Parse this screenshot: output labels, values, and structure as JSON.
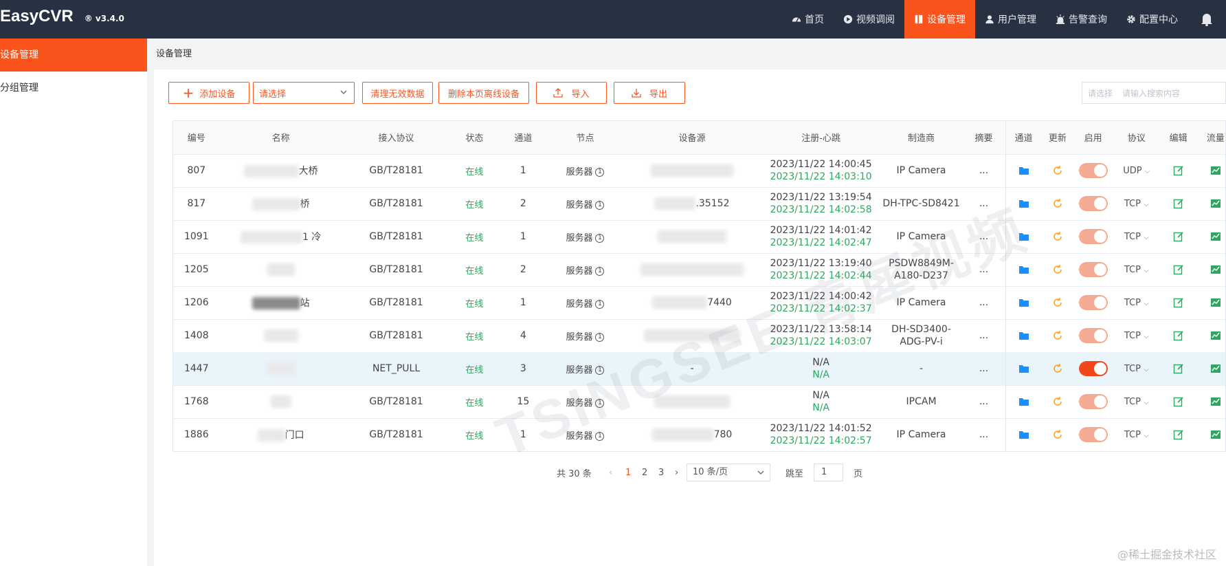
{
  "header": {
    "brand": "EasyCVR",
    "version": "® v3.4.0",
    "nav": [
      {
        "label": "首页",
        "icon": "dashboard-icon"
      },
      {
        "label": "视频调阅",
        "icon": "play-circle-icon"
      },
      {
        "label": "设备管理",
        "icon": "device-icon",
        "active": true
      },
      {
        "label": "用户管理",
        "icon": "user-icon"
      },
      {
        "label": "告警查询",
        "icon": "alarm-icon"
      },
      {
        "label": "配置中心",
        "icon": "gear-icon"
      }
    ]
  },
  "sidebar": {
    "items": [
      {
        "label": "设备管理",
        "active": true
      },
      {
        "label": "分组管理"
      }
    ]
  },
  "breadcrumb": "设备管理",
  "toolbar": {
    "add_label": "添加设备",
    "select_placeholder": "请选择",
    "clear_label": "清理无效数据",
    "delete_offline_label": "删除本页离线设备",
    "import_label": "导入",
    "export_label": "导出",
    "search_select": "请选择",
    "search_placeholder": "请输入搜索内容"
  },
  "table": {
    "columns": [
      "编号",
      "名称",
      "接入协议",
      "状态",
      "通道",
      "节点",
      "设备源",
      "注册-心跳",
      "制造商",
      "摘要",
      "通道",
      "更新",
      "启用",
      "协议",
      "编辑",
      "流量"
    ],
    "rows": [
      {
        "id": "807",
        "name": "大桥",
        "protocol": "GB/T28181",
        "status": "在线",
        "channels": "1",
        "node": "服务器",
        "source": "",
        "reg": "2023/11/22 14:00:45",
        "hb": "2023/11/22 14:03:10",
        "mfr": "IP Camera",
        "summary": "...",
        "enabled": false,
        "proto": "UDP"
      },
      {
        "id": "817",
        "name": "桥",
        "protocol": "GB/T28181",
        "status": "在线",
        "channels": "2",
        "node": "服务器",
        "source": ".35152",
        "reg": "2023/11/22 13:19:54",
        "hb": "2023/11/22 14:02:58",
        "mfr": "DH-TPC-SD8421",
        "summary": "...",
        "enabled": false,
        "proto": "TCP"
      },
      {
        "id": "1091",
        "name": "1 冷",
        "protocol": "GB/T28181",
        "status": "在线",
        "channels": "1",
        "node": "服务器",
        "source": "",
        "reg": "2023/11/22 14:01:42",
        "hb": "2023/11/22 14:02:47",
        "mfr": "IP Camera",
        "summary": "...",
        "enabled": false,
        "proto": "TCP"
      },
      {
        "id": "1205",
        "name": "",
        "protocol": "GB/T28181",
        "status": "在线",
        "channels": "2",
        "node": "服务器",
        "source": "",
        "reg": "2023/11/22 13:19:40",
        "hb": "2023/11/22 14:02:44",
        "mfr": "PSDW8849M-A180-D237",
        "summary": "...",
        "enabled": false,
        "proto": "TCP"
      },
      {
        "id": "1206",
        "name": "站",
        "protocol": "GB/T28181",
        "status": "在线",
        "channels": "1",
        "node": "服务器",
        "source": "7440",
        "reg": "2023/11/22 14:00:42",
        "hb": "2023/11/22 14:02:37",
        "mfr": "IP Camera",
        "summary": "...",
        "enabled": false,
        "proto": "TCP"
      },
      {
        "id": "1408",
        "name": "",
        "protocol": "GB/T28181",
        "status": "在线",
        "channels": "4",
        "node": "服务器",
        "source": "",
        "reg": "2023/11/22 13:58:14",
        "hb": "2023/11/22 14:03:07",
        "mfr": "DH-SD3400-ADG-PV-i",
        "summary": "...",
        "enabled": false,
        "proto": "TCP"
      },
      {
        "id": "1447",
        "name": "",
        "protocol": "NET_PULL",
        "status": "在线",
        "channels": "3",
        "node": "服务器",
        "source": "-",
        "reg": "N/A",
        "hb": "N/A",
        "mfr": "-",
        "summary": "...",
        "enabled": true,
        "proto": "TCP",
        "highlight": true
      },
      {
        "id": "1768",
        "name": "",
        "protocol": "GB/T28181",
        "status": "在线",
        "channels": "15",
        "node": "服务器",
        "source": "",
        "reg": "N/A",
        "hb": "N/A",
        "mfr": "IPCAM",
        "summary": "...",
        "enabled": false,
        "proto": "TCP"
      },
      {
        "id": "1886",
        "name": "门口",
        "protocol": "GB/T28181",
        "status": "在线",
        "channels": "1",
        "node": "服务器",
        "source": "780",
        "reg": "2023/11/22 14:01:52",
        "hb": "2023/11/22 14:02:57",
        "mfr": "IP Camera",
        "summary": "...",
        "enabled": false,
        "proto": "TCP"
      }
    ]
  },
  "pager": {
    "total": "共 30 条",
    "pages": [
      "1",
      "2",
      "3"
    ],
    "current": "1",
    "page_size": "10 条/页",
    "goto_label": "跳至",
    "goto_value": "1",
    "goto_unit": "页"
  },
  "watermark": "TSINGSEE 青犀视频",
  "credit": "@稀土掘金技术社区",
  "colors": {
    "accent": "#fa541c",
    "topbar": "#273142",
    "online": "#2aa85f"
  }
}
